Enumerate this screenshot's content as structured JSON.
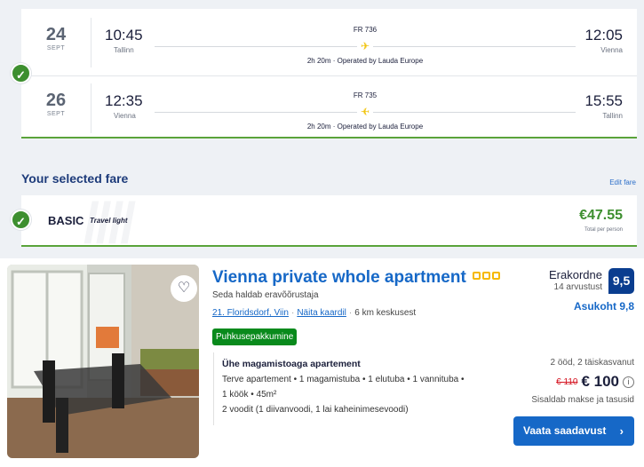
{
  "flights": [
    {
      "day": "24",
      "month": "SEPT",
      "dep_time": "10:45",
      "dep_city": "Tallinn",
      "flight_no": "FR 736",
      "duration": "2h 20m · Operated by Lauda Europe",
      "arr_time": "12:05",
      "arr_city": "Vienna"
    },
    {
      "day": "26",
      "month": "SEPT",
      "dep_time": "12:35",
      "dep_city": "Vienna",
      "flight_no": "FR 735",
      "duration": "2h 20m · Operated by Lauda Europe",
      "arr_time": "15:55",
      "arr_city": "Tallinn"
    }
  ],
  "fare": {
    "section_title": "Your selected fare",
    "edit_label": "Edit fare",
    "name": "BASIC",
    "subtitle": "Travel light",
    "price": "€47.55",
    "per": "Total per person"
  },
  "hotel": {
    "title": "Vienna private whole apartment",
    "managed": "Seda haldab eravõõrustaja",
    "district": "21. Floridsdorf, Viin",
    "map_link": "Näita kaardil",
    "distance": "6 km keskusest",
    "deal": "Puhkusepakkumine",
    "room_name": "Ühe magamistoaga apartement",
    "room_line1": "Terve apartement • 1 magamistuba • 1 elutuba • 1 vannituba •",
    "room_line2": "1 köök • 45m²",
    "room_line3": "2 voodit (1 diivanvoodi, 1 lai kaheinimesevoodi)",
    "review_word": "Erakordne",
    "review_count": "14 arvustust",
    "score": "9,5",
    "location_score": "Asukoht 9,8",
    "guests": "2 ööd, 2 täiskasvanut",
    "old_price": "€ 110",
    "new_price": "€ 100",
    "included": "Sisaldab makse ja tasusid",
    "cta": "Vaata saadavust",
    "star_count": 3,
    "colors": {
      "accent": "#1668c7",
      "deal": "#098a1c",
      "score_bg": "#0a3d8f",
      "check": "#3d8f2f"
    }
  }
}
